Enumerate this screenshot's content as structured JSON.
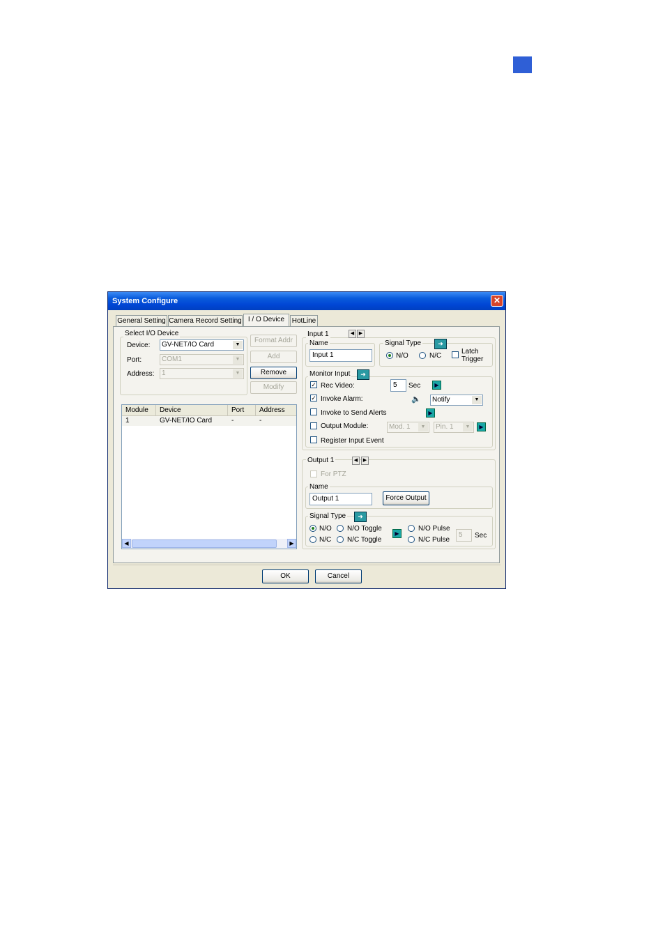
{
  "window": {
    "title": "System Configure"
  },
  "tabs": [
    "General Setting",
    "Camera Record Setting",
    "I / O Device",
    "HotLine"
  ],
  "select_device": {
    "group_label": "Select I/O Device",
    "device_label": "Device:",
    "device_value": "GV-NET/IO Card",
    "port_label": "Port:",
    "port_value": "COM1",
    "address_label": "Address:",
    "address_value": "1",
    "buttons": {
      "format_addr": "Format Addr",
      "add": "Add",
      "remove": "Remove",
      "modify": "Modify"
    }
  },
  "device_list": {
    "columns": [
      "Module",
      "Device",
      "Port",
      "Address"
    ],
    "rows": [
      {
        "module": "1",
        "device": "GV-NET/IO Card",
        "port": "-",
        "address": "-"
      }
    ]
  },
  "input": {
    "title": "Input 1",
    "name_label": "Name",
    "name_value": "Input 1",
    "signal_type_label": "Signal Type",
    "no_label": "N/O",
    "nc_label": "N/C",
    "selected": "N/O",
    "latch_trigger_label": "Latch\nTrigger"
  },
  "monitor_input": {
    "title": "Monitor Input",
    "rec_video_label": "Rec Video:",
    "rec_video_checked": true,
    "rec_seconds": "5",
    "sec_label": "Sec",
    "invoke_alarm_label": "Invoke Alarm:",
    "invoke_alarm_checked": true,
    "alarm_value": "Notify",
    "send_alerts_label": "Invoke to Send Alerts",
    "output_module_label": "Output Module:",
    "mod_value": "Mod. 1",
    "pin_value": "Pin. 1",
    "register_event_label": "Register Input Event"
  },
  "output": {
    "title": "Output 1",
    "for_ptz_label": "For PTZ",
    "name_label": "Name",
    "name_value": "Output 1",
    "force_output_label": "Force Output",
    "signal_type_label": "Signal Type",
    "no_label": "N/O",
    "no_toggle_label": "N/O Toggle",
    "no_pulse_label": "N/O Pulse",
    "nc_label": "N/C",
    "nc_toggle_label": "N/C Toggle",
    "nc_pulse_label": "N/C Pulse",
    "pulse_seconds": "5",
    "sec_label": "Sec",
    "selected": "N/O"
  },
  "footer": {
    "ok": "OK",
    "cancel": "Cancel"
  },
  "colors": {
    "titlebar": "#0a5bdc",
    "window_bg": "#ece9d8",
    "corner_mark": "#2f5fd6"
  },
  "icons": [
    "close-icon",
    "folder-arrow-icon",
    "play-arrow-icon",
    "speaker-icon",
    "prev-arrow-icon",
    "next-arrow-icon"
  ]
}
